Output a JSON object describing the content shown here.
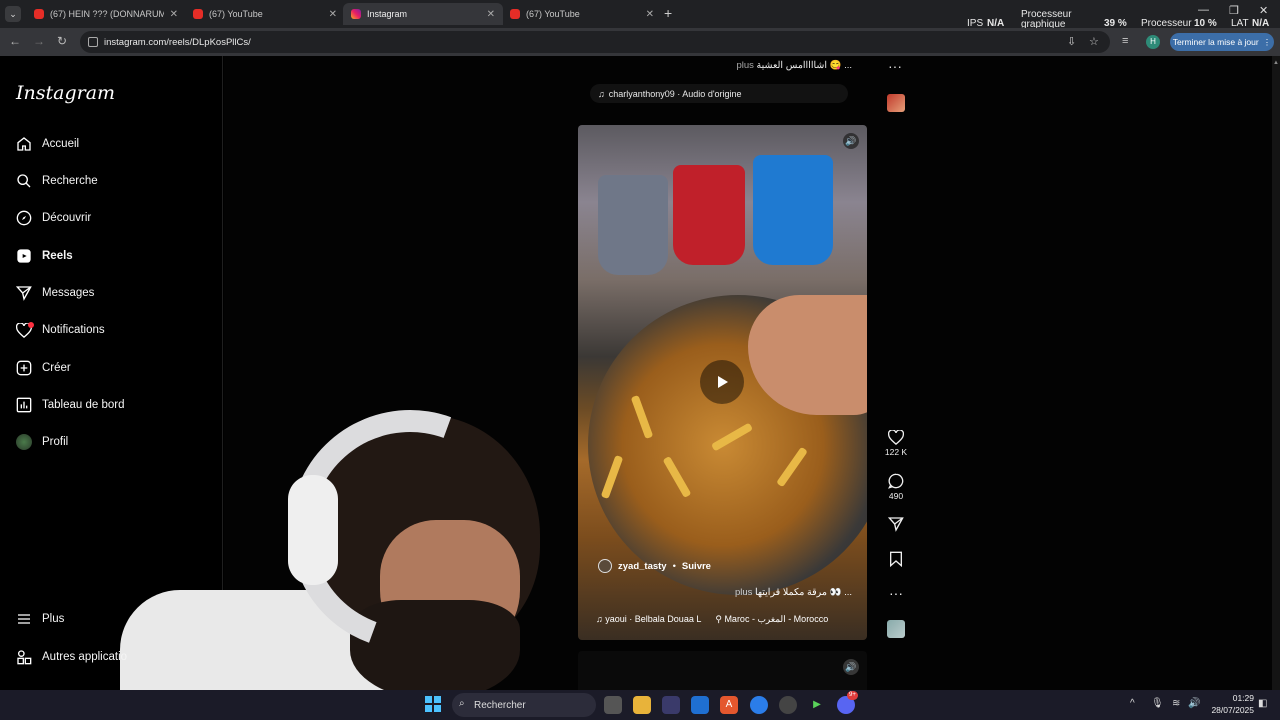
{
  "browser": {
    "tabs": [
      {
        "label": "(67) HEIN ??? (DONNARUMMA",
        "icon": "youtube-icon",
        "active": false
      },
      {
        "label": "(67) YouTube",
        "icon": "youtube-icon",
        "active": false
      },
      {
        "label": "Instagram",
        "icon": "instagram-icon",
        "active": true
      },
      {
        "label": "(67) YouTube",
        "icon": "youtube-icon",
        "active": false
      }
    ],
    "url": "instagram.com/reels/DLpKosPllCs/",
    "update_button": "Terminer la mise à jour",
    "profile_initial": "H"
  },
  "perf_overlay": {
    "ips_label": "IPS",
    "ips_value": "N/A",
    "gpu_label_1": "Processeur",
    "gpu_label_2": "graphique",
    "gpu_value": "39 %",
    "cpu_label": "Processeur",
    "cpu_value": "10 %",
    "lat_label": "LAT",
    "lat_value": "N/A"
  },
  "sidebar": {
    "logo": "Instagram",
    "items": [
      {
        "label": "Accueil",
        "icon": "home-icon"
      },
      {
        "label": "Recherche",
        "icon": "search-icon"
      },
      {
        "label": "Découvrir",
        "icon": "compass-icon"
      },
      {
        "label": "Reels",
        "icon": "reels-icon"
      },
      {
        "label": "Messages",
        "icon": "send-icon"
      },
      {
        "label": "Notifications",
        "icon": "heart-icon"
      },
      {
        "label": "Créer",
        "icon": "plus-square-icon"
      },
      {
        "label": "Tableau de bord",
        "icon": "dashboard-icon"
      },
      {
        "label": "Profil",
        "icon": "profile-avatar"
      }
    ],
    "more_label": "Plus",
    "other_apps_label": "Autres applicatio"
  },
  "prev_reel": {
    "caption": "اشااااامس العشية 😋 ...",
    "caption_more": "plus",
    "audio": "charlyanthony09 · Audio d'origine"
  },
  "reel": {
    "username": "zyad_tasty",
    "separator": "•",
    "follow": "Suivre",
    "caption": "مرقة مكملا قرايتها 👀 ...",
    "caption_more": "plus",
    "audio": "yaoui · Belbala  Douaa L",
    "location": "Maroc - المغرب - Morocco",
    "likes": "122 K",
    "comments": "490"
  },
  "taskbar": {
    "search_label": "Rechercher",
    "time": "01:29",
    "date": "28/07/2025",
    "discord_badge": "9+"
  }
}
